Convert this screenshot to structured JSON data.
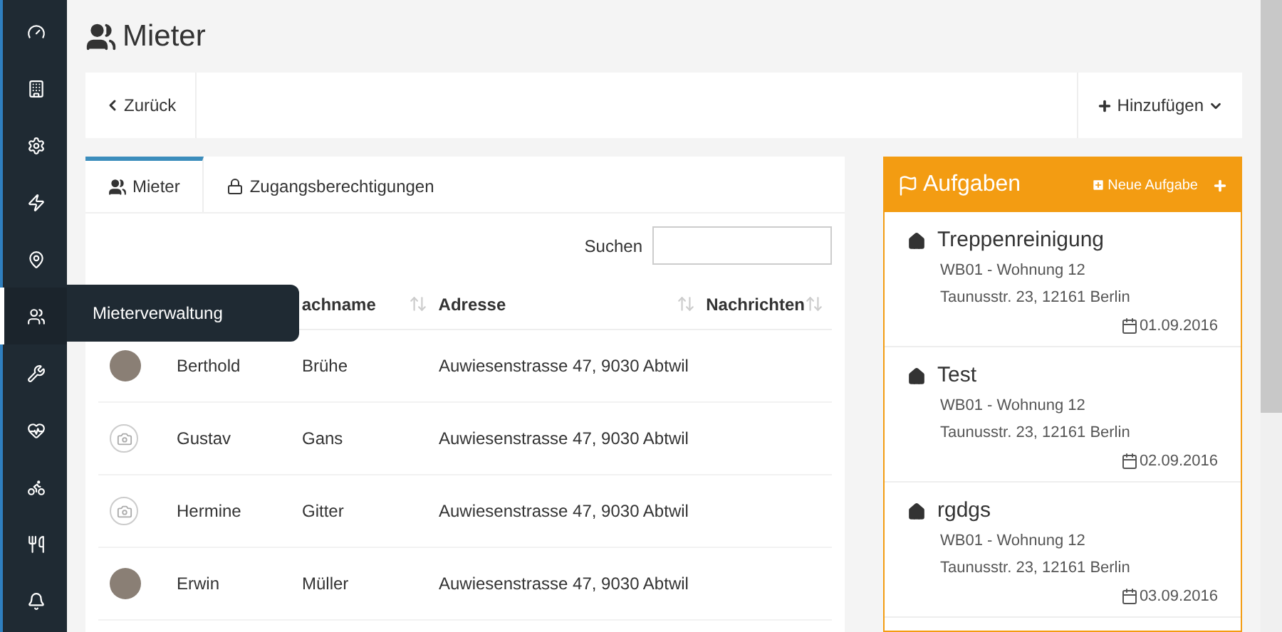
{
  "sidebar": {
    "items": [
      {
        "selected": false
      },
      {
        "selected": false
      },
      {
        "selected": false
      },
      {
        "selected": false
      },
      {
        "selected": false
      },
      {
        "selected": true
      },
      {
        "selected": false
      },
      {
        "selected": false
      },
      {
        "selected": false
      },
      {
        "selected": false
      },
      {
        "selected": false
      }
    ],
    "tooltip": "Mieterverwaltung"
  },
  "page_title": "Mieter",
  "toolbar": {
    "back": "Zurück",
    "add": "Hinzufügen"
  },
  "tabs": [
    {
      "label": "Mieter",
      "selected": true
    },
    {
      "label": "Zugangsberechtigungen",
      "selected": false
    }
  ],
  "search": {
    "label": "Suchen"
  },
  "table": {
    "columns": [
      {
        "label": "achname"
      },
      {
        "label": "Adresse"
      },
      {
        "label": "Nachrichten"
      }
    ],
    "rows": [
      {
        "kind": "photo",
        "first": "Berthold",
        "last": "Brühe",
        "address": "Auwiesenstrasse 47, 9030 Abtwil"
      },
      {
        "kind": "no-photo",
        "first": "Gustav",
        "last": "Gans",
        "address": "Auwiesenstrasse 47, 9030 Abtwil"
      },
      {
        "kind": "no-photo",
        "first": "Hermine",
        "last": "Gitter",
        "address": "Auwiesenstrasse 47, 9030 Abtwil"
      },
      {
        "kind": "photo",
        "first": "Erwin",
        "last": "Müller",
        "address": "Auwiesenstrasse 47, 9030 Abtwil"
      }
    ]
  },
  "tasks": {
    "title": "Aufgaben",
    "new": "Neue Aufgabe",
    "items": [
      {
        "title": "Treppenreinigung",
        "unit": "WB01 - Wohnung 12",
        "address": "Taunusstr. 23, 12161 Berlin",
        "date": "01.09.2016"
      },
      {
        "title": "Test",
        "unit": "WB01 - Wohnung 12",
        "address": "Taunusstr. 23, 12161 Berlin",
        "date": "02.09.2016"
      },
      {
        "title": "rgdgs",
        "unit": "WB01 - Wohnung 12",
        "address": "Taunusstr. 23, 12161 Berlin",
        "date": "03.09.2016"
      }
    ]
  }
}
